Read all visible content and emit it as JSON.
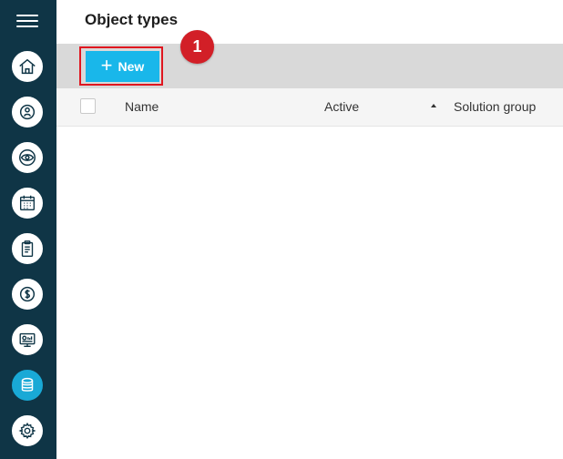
{
  "page": {
    "title": "Object types"
  },
  "sidebar": {
    "items": [
      {
        "icon": "home-icon"
      },
      {
        "icon": "contacts-icon"
      },
      {
        "icon": "eye-icon"
      },
      {
        "icon": "calendar-icon"
      },
      {
        "icon": "clipboard-icon"
      },
      {
        "icon": "dollar-icon"
      },
      {
        "icon": "dashboard-icon"
      },
      {
        "icon": "database-icon",
        "active": true
      },
      {
        "icon": "gear-icon"
      }
    ]
  },
  "toolbar": {
    "new_label": "New",
    "new_icon": "plus-icon",
    "step_badge": "1"
  },
  "table": {
    "columns": [
      "Name",
      "Active",
      "Solution group"
    ],
    "sort_column": "Solution group",
    "rows": []
  },
  "colors": {
    "rail": "#0f3546",
    "accent": "#19b7ea",
    "highlight": "#e0161f",
    "badge": "#d21f27"
  }
}
